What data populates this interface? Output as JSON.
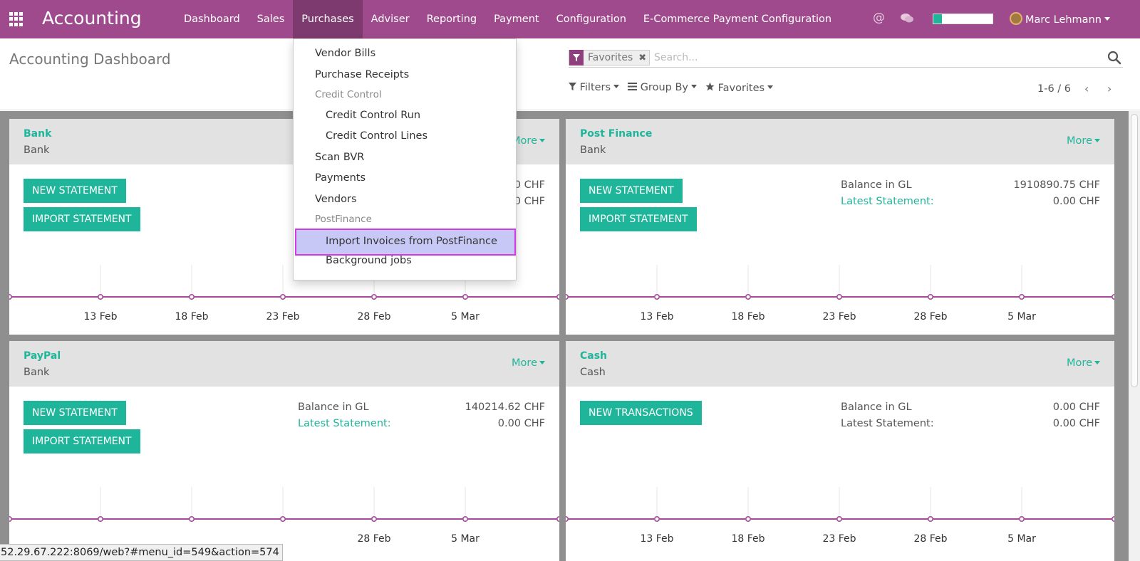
{
  "navbar": {
    "app_title": "Accounting",
    "menu": [
      "Dashboard",
      "Sales",
      "Purchases",
      "Adviser",
      "Reporting",
      "Payment",
      "Configuration",
      "E-Commerce Payment Configuration"
    ],
    "active_menu": "Purchases",
    "user_name": "Marc Lehmann",
    "at_icon": "@",
    "progress_fraction": 0.15,
    "colors": {
      "bar": "#9e4a8c",
      "active": "#7c3a6e",
      "accent": "#1fb59b"
    }
  },
  "control": {
    "page_title": "Accounting Dashboard",
    "facet_label": "Favorites",
    "facet_remove": "✖",
    "search_placeholder": "Search...",
    "filters_label": "Filters",
    "groupby_label": "Group By",
    "favorites_label": "Favorites",
    "pager_text": "1-6 / 6",
    "pager_prev": "‹",
    "pager_next": "›"
  },
  "dropdown": {
    "vendor_bills": "Vendor Bills",
    "purchase_receipts": "Purchase Receipts",
    "credit_control_header": "Credit Control",
    "credit_control_run": "Credit Control Run",
    "credit_control_lines": "Credit Control Lines",
    "scan_bvr": "Scan BVR",
    "payments": "Payments",
    "vendors": "Vendors",
    "postfinance_header": "PostFinance",
    "import_invoices": "Import Invoices from PostFinance",
    "background_jobs": "Background jobs"
  },
  "cards": [
    {
      "name": "Bank",
      "type": "Bank",
      "more": "More",
      "buttons": [
        "NEW STATEMENT",
        "IMPORT STATEMENT"
      ],
      "stats": [
        {
          "label": "",
          "value": "0.00 CHF"
        },
        {
          "label": "",
          "value": "0.00 CHF"
        }
      ],
      "ticks": [
        "13 Feb",
        "18 Feb",
        "23 Feb",
        "28 Feb",
        "5 Mar"
      ]
    },
    {
      "name": "Post Finance",
      "type": "Bank",
      "more": "More",
      "buttons": [
        "NEW STATEMENT",
        "IMPORT STATEMENT"
      ],
      "stats": [
        {
          "label": "Balance in GL",
          "value": "1910890.75 CHF"
        },
        {
          "label": "Latest Statement:",
          "value": "0.00 CHF"
        }
      ],
      "ticks": [
        "13 Feb",
        "18 Feb",
        "23 Feb",
        "28 Feb",
        "5 Mar"
      ]
    },
    {
      "name": "PayPal",
      "type": "Bank",
      "more": "More",
      "buttons": [
        "NEW STATEMENT",
        "IMPORT STATEMENT"
      ],
      "stats": [
        {
          "label": "Balance in GL",
          "value": "140214.62 CHF"
        },
        {
          "label": "Latest Statement:",
          "value": "0.00 CHF"
        }
      ],
      "ticks": [
        "28 Feb",
        "5 Mar"
      ]
    },
    {
      "name": "Cash",
      "type": "Cash",
      "more": "More",
      "buttons": [
        "NEW TRANSACTIONS"
      ],
      "stats": [
        {
          "label": "Balance in GL",
          "value": "0.00 CHF"
        },
        {
          "label": "Latest Statement:",
          "value": "0.00 CHF"
        }
      ],
      "ticks": [
        "13 Feb",
        "18 Feb",
        "23 Feb",
        "28 Feb",
        "5 Mar"
      ]
    }
  ],
  "status_url": "52.29.67.222:8069/web?#menu_id=549&action=574"
}
